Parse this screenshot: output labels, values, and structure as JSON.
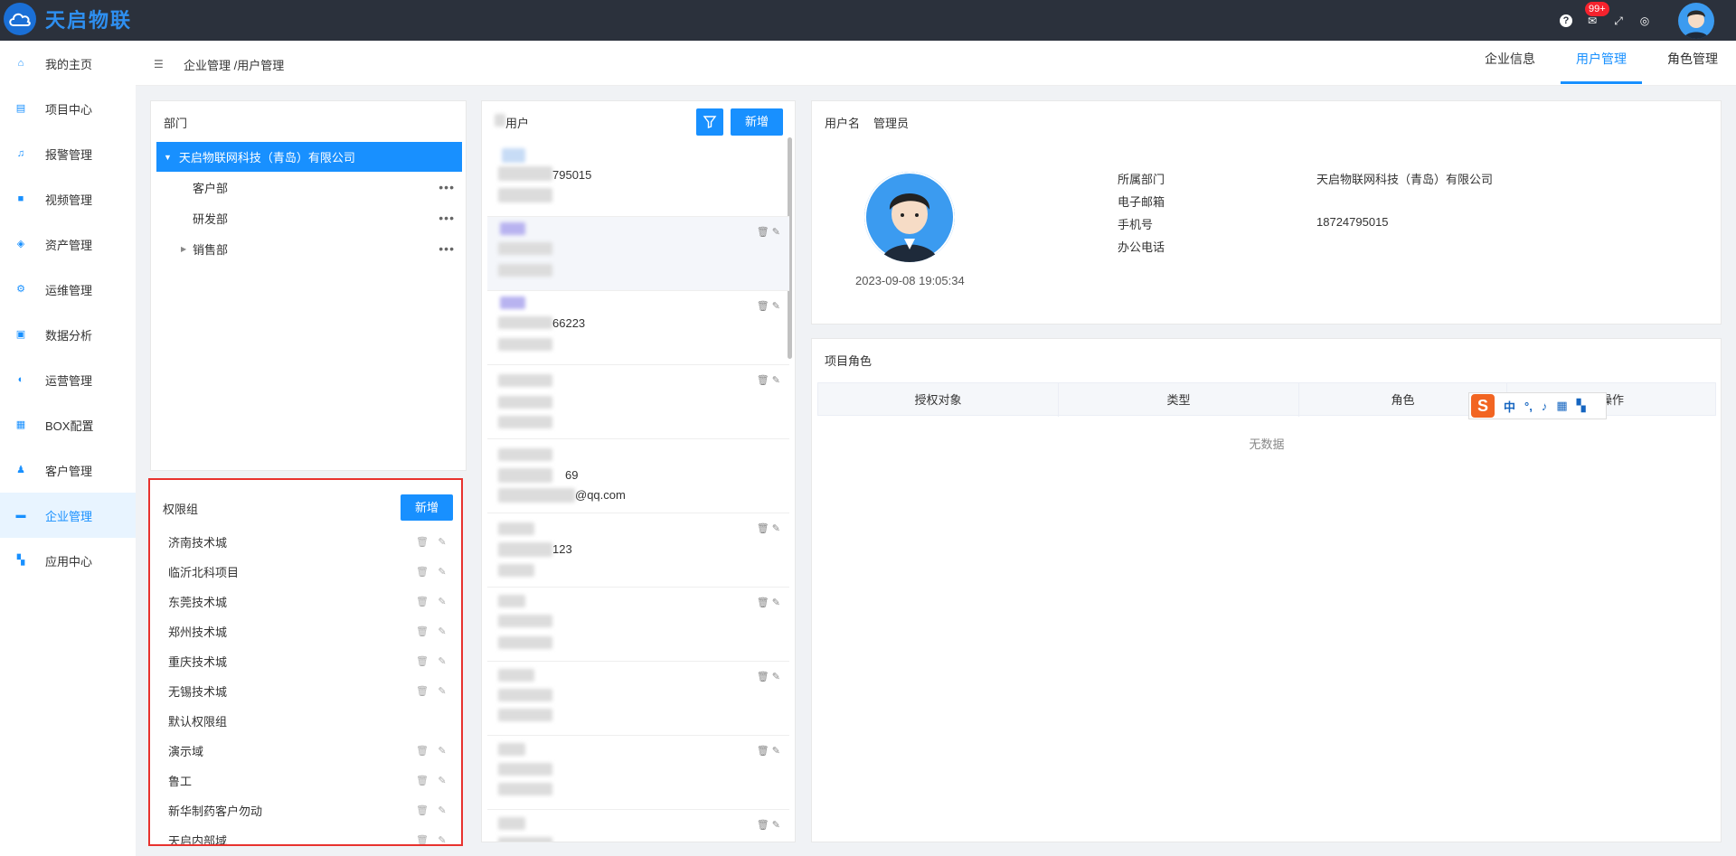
{
  "app": {
    "logo_text": "天启物联",
    "notif_count": "99+"
  },
  "sidebar": {
    "items": [
      {
        "label": "我的主页",
        "icon": "home-icon"
      },
      {
        "label": "项目中心",
        "icon": "project-icon"
      },
      {
        "label": "报警管理",
        "icon": "bell-icon"
      },
      {
        "label": "视频管理",
        "icon": "video-icon"
      },
      {
        "label": "资产管理",
        "icon": "asset-icon"
      },
      {
        "label": "运维管理",
        "icon": "gear-icon"
      },
      {
        "label": "数据分析",
        "icon": "monitor-icon"
      },
      {
        "label": "运营管理",
        "icon": "ops-icon"
      },
      {
        "label": "BOX配置",
        "icon": "box-icon"
      },
      {
        "label": "客户管理",
        "icon": "users-icon"
      },
      {
        "label": "企业管理",
        "icon": "briefcase-icon"
      },
      {
        "label": "应用中心",
        "icon": "apps-icon"
      }
    ],
    "active_index": 10
  },
  "header": {
    "breadcrumb": "企业管理 /用户管理",
    "tabs": [
      "企业信息",
      "用户管理",
      "角色管理"
    ],
    "active_tab": 1
  },
  "dept": {
    "title": "部门",
    "root": "天启物联网科技（青岛）有限公司",
    "children": [
      "客户部",
      "研发部",
      "销售部"
    ]
  },
  "perm": {
    "title": "权限组",
    "add_label": "新增",
    "items": [
      "济南技术城",
      "临沂北科项目",
      "东莞技术城",
      "郑州技术城",
      "重庆技术城",
      "无锡技术城",
      "默认权限组",
      "演示域",
      "鲁工",
      "新华制药客户勿动",
      "天启内部域"
    ]
  },
  "users": {
    "title": "用户",
    "add_label": "新增",
    "visible_fragments": [
      "795015",
      "66223",
      "69",
      "@qq.com",
      "123"
    ]
  },
  "detail": {
    "username_label": "用户名",
    "username_value": "管理员",
    "created": "2023-09-08 19:05:34",
    "fields": [
      {
        "label": "所属部门",
        "value": "天启物联网科技（青岛）有限公司"
      },
      {
        "label": "电子邮箱",
        "value": ""
      },
      {
        "label": "手机号",
        "value": "18724795015"
      },
      {
        "label": "办公电话",
        "value": ""
      }
    ]
  },
  "roles": {
    "title": "项目角色",
    "columns": [
      "授权对象",
      "类型",
      "角色",
      "操作"
    ],
    "empty_text": "无数据"
  },
  "ime": {
    "mode": "中"
  }
}
